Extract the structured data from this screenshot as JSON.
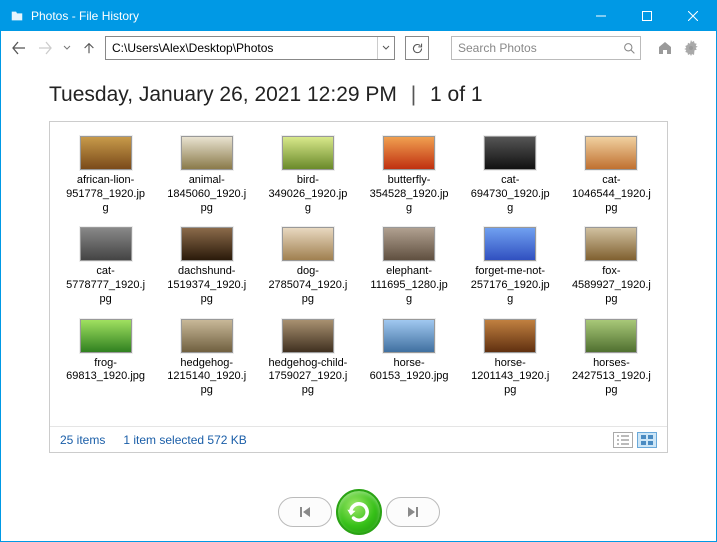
{
  "window": {
    "title": "Photos - File History"
  },
  "address": {
    "path": "C:\\Users\\Alex\\Desktop\\Photos"
  },
  "search": {
    "placeholder": "Search Photos"
  },
  "heading": {
    "timestamp": "Tuesday, January 26, 2021 12:29 PM",
    "page": "1 of 1"
  },
  "items": [
    {
      "name": "african-lion-951778_1920.jpg"
    },
    {
      "name": "animal-1845060_1920.jpg"
    },
    {
      "name": "bird-349026_1920.jpg"
    },
    {
      "name": "butterfly-354528_1920.jpg"
    },
    {
      "name": "cat-694730_1920.jpg"
    },
    {
      "name": "cat-1046544_1920.jpg"
    },
    {
      "name": "cat-5778777_1920.jpg"
    },
    {
      "name": "dachshund-1519374_1920.jpg"
    },
    {
      "name": "dog-2785074_1920.jpg"
    },
    {
      "name": "elephant-111695_1280.jpg"
    },
    {
      "name": "forget-me-not-257176_1920.jpg"
    },
    {
      "name": "fox-4589927_1920.jpg"
    },
    {
      "name": "frog-69813_1920.jpg"
    },
    {
      "name": "hedgehog-1215140_1920.jpg"
    },
    {
      "name": "hedgehog-child-1759027_1920.jpg"
    },
    {
      "name": "horse-60153_1920.jpg"
    },
    {
      "name": "horse-1201143_1920.jpg"
    },
    {
      "name": "horses-2427513_1920.jpg"
    }
  ],
  "status": {
    "count": "25 items",
    "selection": "1 item selected  572 KB"
  }
}
